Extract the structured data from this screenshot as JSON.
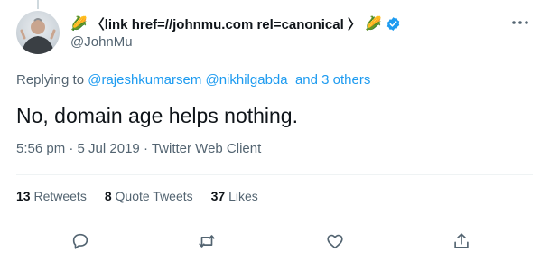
{
  "tweet": {
    "author": {
      "name_prefix_emoji": "🌽",
      "display_name": "〈link href=//johnmu.com rel=canonical 〉",
      "name_suffix_emoji": "🌽",
      "handle": "@JohnMu",
      "verified": true
    },
    "replying": {
      "prefix": "Replying to ",
      "mentions": [
        "@rajeshkumarsem",
        "@nikhilgabda"
      ],
      "others": "and 3 others"
    },
    "text": "No, domain age helps nothing.",
    "meta": {
      "time": "5:56 pm",
      "separator": " · ",
      "date": "5 Jul 2019",
      "client": "Twitter Web Client"
    },
    "stats": {
      "retweets_count": "13",
      "retweets_label": " Retweets",
      "quotes_count": "8",
      "quotes_label": " Quote Tweets",
      "likes_count": "37",
      "likes_label": " Likes"
    }
  },
  "icons": {
    "more": "more-icon",
    "verified": "verified-badge-icon",
    "reply": "reply-icon",
    "retweet": "retweet-icon",
    "like": "heart-icon",
    "share": "share-icon"
  },
  "colors": {
    "accent": "#1d9bf0",
    "secondary_text": "#536471",
    "primary_text": "#0f1419",
    "divider": "#eff3f4"
  }
}
